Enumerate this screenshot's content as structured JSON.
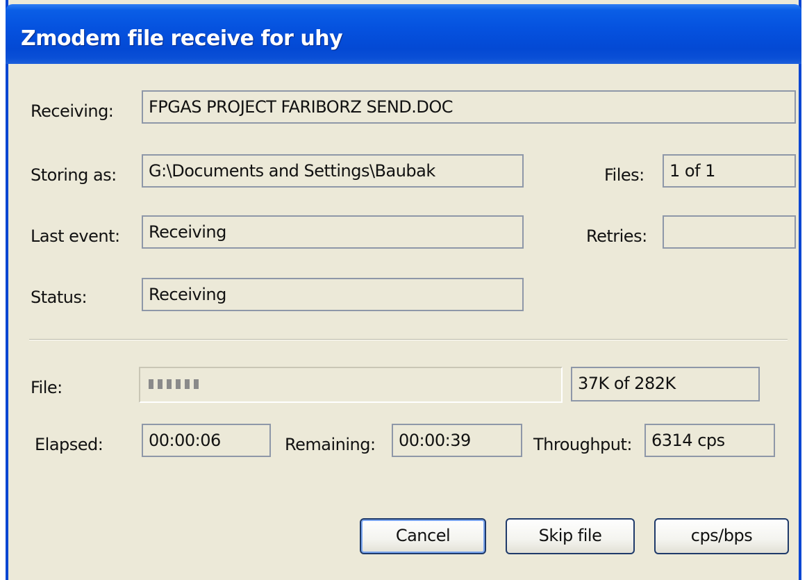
{
  "window": {
    "title": "Zmodem file receive for uhy"
  },
  "fields": {
    "receiving": {
      "label": "Receiving:",
      "value": "FPGAS PROJECT FARIBORZ SEND.DOC"
    },
    "storing_as": {
      "label": "Storing as:",
      "value": "G:\\Documents and Settings\\Baubak"
    },
    "files": {
      "label": "Files:",
      "value": "1 of 1"
    },
    "last_event": {
      "label": "Last event:",
      "value": "Receiving"
    },
    "retries": {
      "label": "Retries:",
      "value": ""
    },
    "status": {
      "label": "Status:",
      "value": "Receiving"
    }
  },
  "progress": {
    "label": "File:",
    "size_text": "37K of 282K",
    "fraction": 0.131
  },
  "timing": {
    "elapsed": {
      "label": "Elapsed:",
      "value": "00:00:06"
    },
    "remaining": {
      "label": "Remaining:",
      "value": "00:00:39"
    },
    "throughput": {
      "label": "Throughput:",
      "value": "6314 cps"
    }
  },
  "buttons": {
    "cancel": "Cancel",
    "skip_file": "Skip file",
    "cps_bps": "cps/bps"
  },
  "colors": {
    "titlebar": "#0553df",
    "dialog_bg": "#ece9d8",
    "field_border": "#8e97a8",
    "progress_fill": "#8a8a8a"
  }
}
